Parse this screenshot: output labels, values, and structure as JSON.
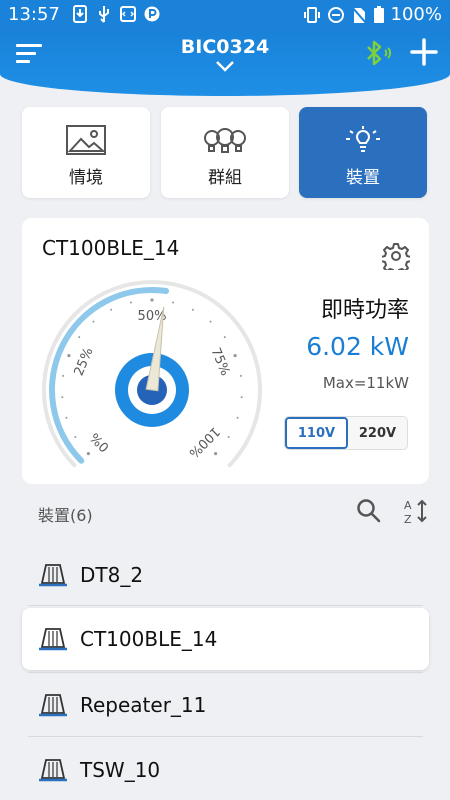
{
  "status_bar": {
    "time": "13:57",
    "battery": "100%"
  },
  "header": {
    "title": "BIC0324"
  },
  "tabs": [
    {
      "label": "情境",
      "icon": "image-icon",
      "active": false
    },
    {
      "label": "群組",
      "icon": "bulb-group-icon",
      "active": false
    },
    {
      "label": "裝置",
      "icon": "bulb-icon",
      "active": true
    }
  ],
  "device_card": {
    "name": "CT100BLE_14",
    "power_label": "即時功率",
    "power_value": "6.02 kW",
    "power_max": "Max=11kW",
    "gauge": {
      "level_percent": 53,
      "ticks": [
        "0%",
        "25%",
        "50%",
        "75%",
        "100%"
      ]
    },
    "voltage_options": [
      "110V",
      "220V"
    ],
    "voltage_selected": "110V"
  },
  "device_list": {
    "header": "裝置(6)",
    "items": [
      "DT8_2",
      "CT100BLE_14",
      "Repeater_11",
      "TSW_10"
    ],
    "selected": "CT100BLE_14"
  },
  "colors": {
    "primary": "#1a82d8",
    "active_tile": "#2b6fbf",
    "value_blue": "#1a7fd4",
    "bt_green": "#7fd03b"
  }
}
